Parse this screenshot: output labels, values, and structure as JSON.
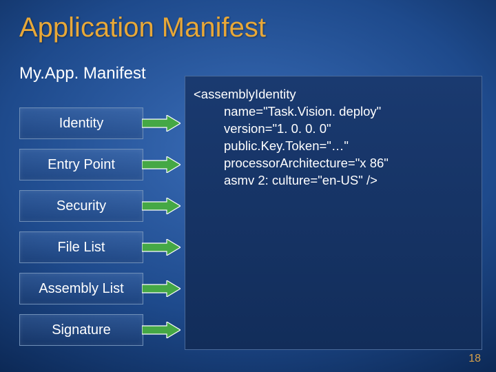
{
  "title": "Application Manifest",
  "subtitle": "My.App. Manifest",
  "boxes": [
    {
      "label": "Identity"
    },
    {
      "label": "Entry Point"
    },
    {
      "label": "Security"
    },
    {
      "label": "File List"
    },
    {
      "label": "Assembly List"
    },
    {
      "label": "Signature"
    }
  ],
  "code": {
    "l0": "<assemblyIdentity",
    "l1": "name=\"Task.Vision. deploy\"",
    "l2": "version=\"1. 0. 0. 0\"",
    "l3": "public.Key.Token=\"…\"",
    "l4": "processorArchitecture=\"x 86\"",
    "l5": "asmv 2: culture=\"en-US\" />"
  },
  "pageNumber": "18",
  "colors": {
    "arrowFill": "#45a845",
    "arrowStroke": "#ffffff"
  }
}
